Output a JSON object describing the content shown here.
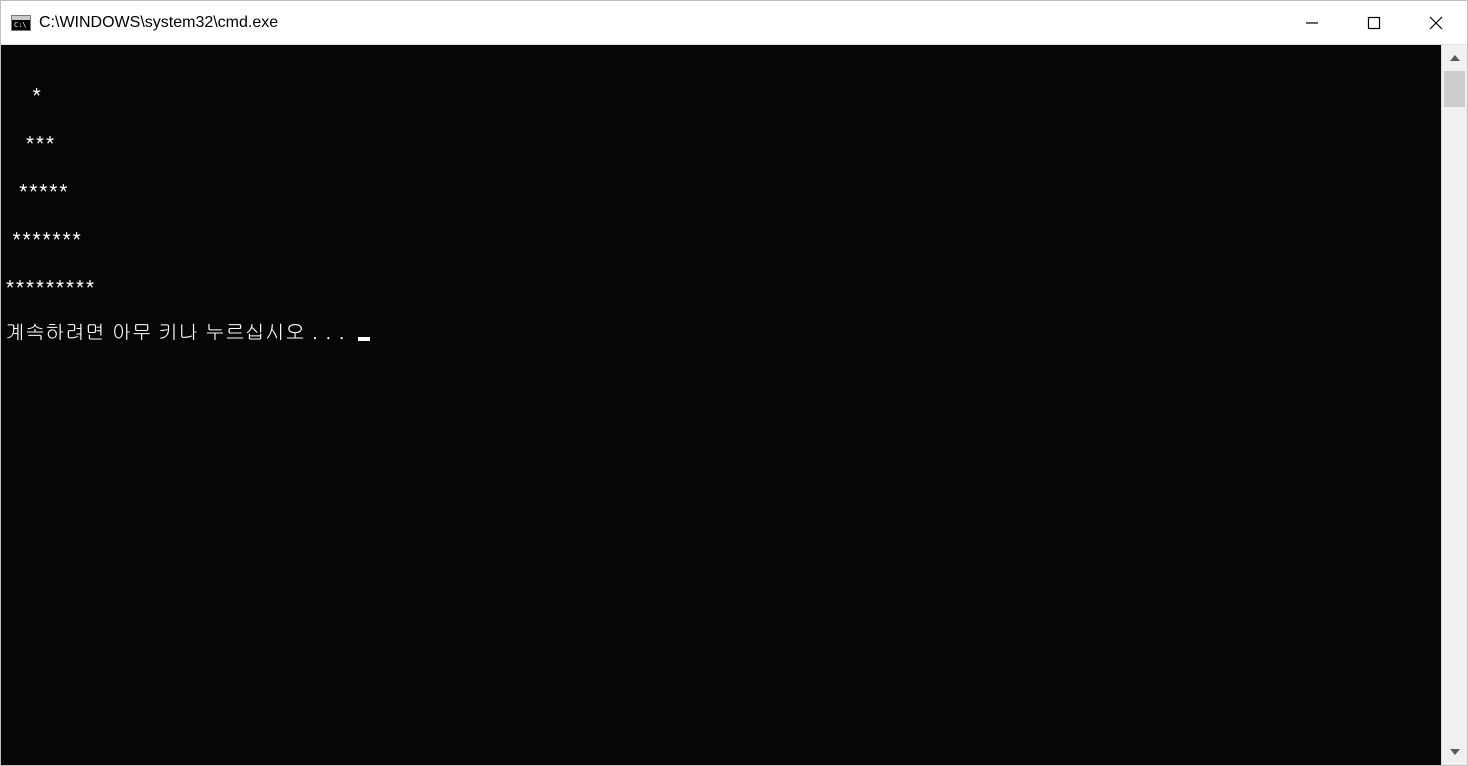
{
  "window": {
    "title": "C:\\WINDOWS\\system32\\cmd.exe"
  },
  "console": {
    "lines": [
      "    *",
      "   ***",
      "  *****",
      " *******",
      "*********"
    ],
    "prompt": "계속하려면 아무 키나 누르십시오 . . . "
  }
}
